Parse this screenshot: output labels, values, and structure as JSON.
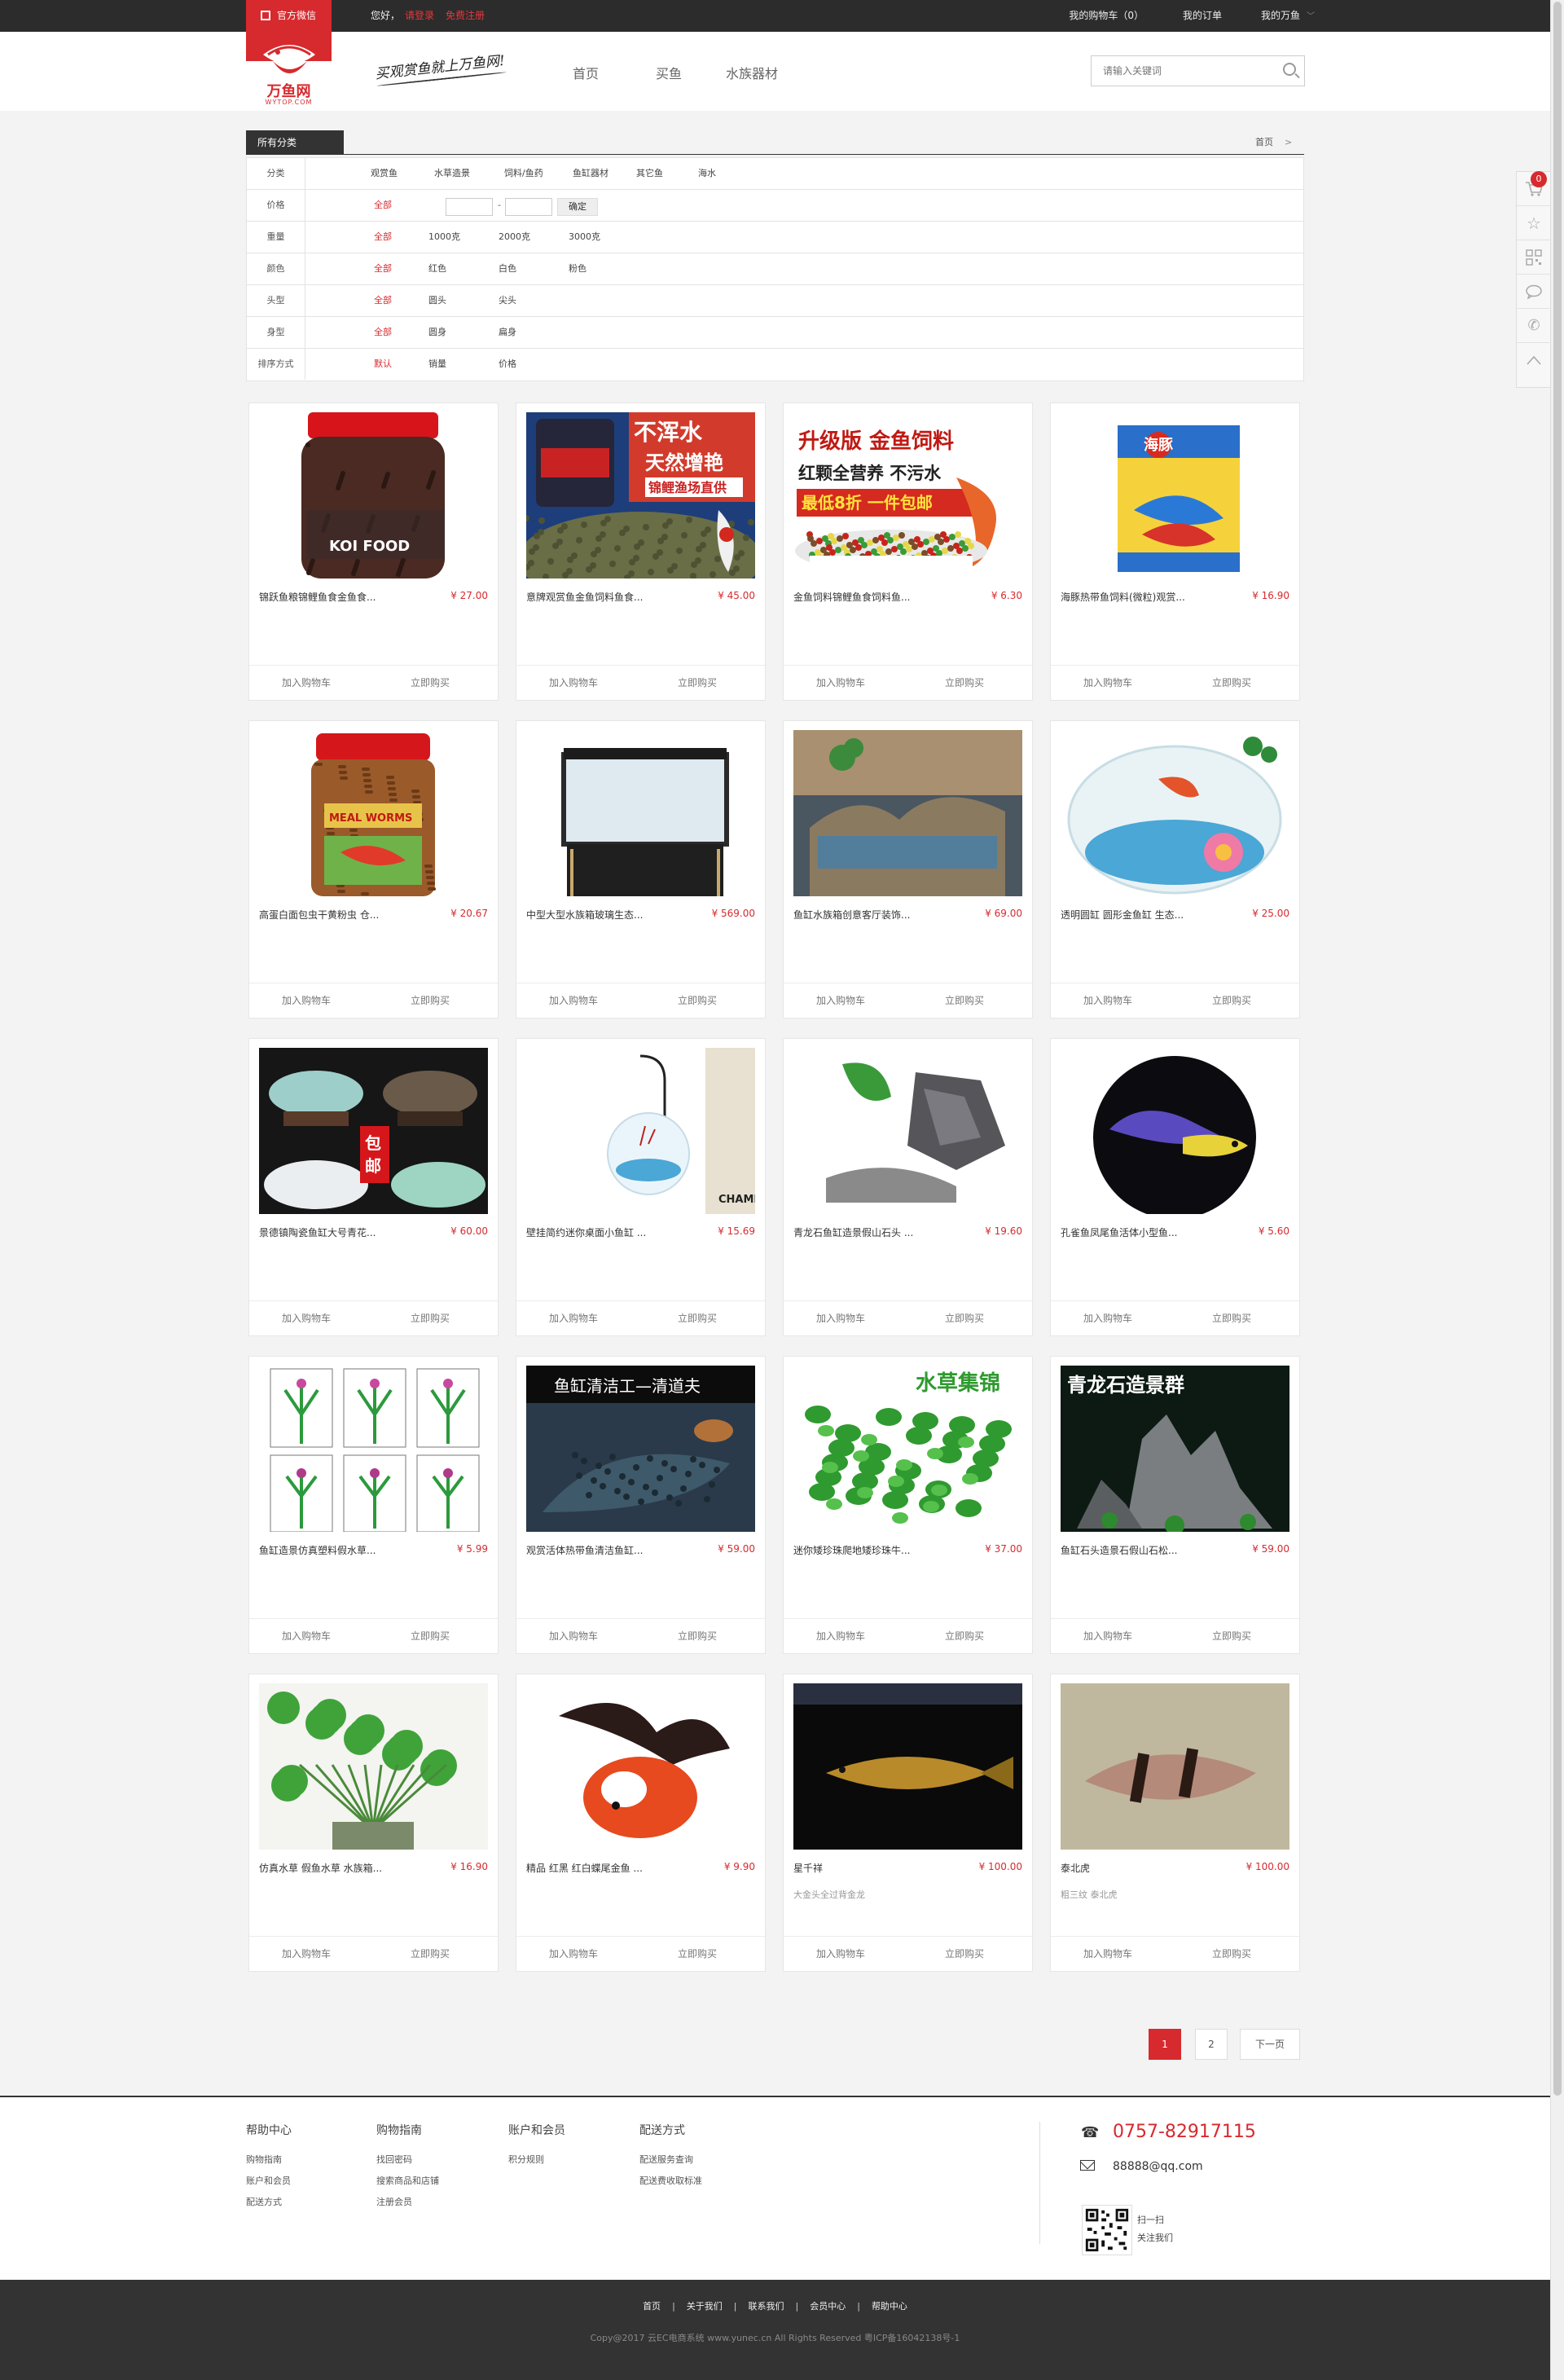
{
  "topbar": {
    "official_label": "官方微信",
    "greeting": "您好，",
    "login": "请登录",
    "register": "免费注册",
    "cart": "我的购物车（0）",
    "orders": "我的订单",
    "account": "我的万鱼"
  },
  "header": {
    "logo_text": "万鱼网",
    "logo_sub": "WYTOP.COM",
    "slogan": "买观赏鱼就上万鱼网!",
    "nav": [
      "首页",
      "买鱼",
      "水族器材"
    ],
    "search_placeholder": "请输入关键词"
  },
  "breadcrumb": {
    "all_categories": "所有分类",
    "home": "首页",
    "arrow": ">"
  },
  "filters": [
    {
      "label": "分类",
      "options": [
        "观赏鱼",
        "水草造景",
        "饲料/鱼药",
        "鱼缸器材",
        "其它鱼",
        "海水"
      ],
      "active": -1
    },
    {
      "label": "价格",
      "options": [
        "全部"
      ],
      "active": 0,
      "price": true,
      "dash": "-",
      "confirm": "确定"
    },
    {
      "label": "重量",
      "options": [
        "全部",
        "1000克",
        "2000克",
        "3000克"
      ],
      "active": 0
    },
    {
      "label": "颜色",
      "options": [
        "全部",
        "红色",
        "白色",
        "粉色"
      ],
      "active": 0
    },
    {
      "label": "头型",
      "options": [
        "全部",
        "圆头",
        "尖头"
      ],
      "active": 0
    },
    {
      "label": "身型",
      "options": [
        "全部",
        "圆身",
        "扁身"
      ],
      "active": 0
    },
    {
      "label": "排序方式",
      "options": [
        "默认",
        "销量",
        "价格"
      ],
      "active": 0
    }
  ],
  "product_actions": {
    "add_cart": "加入购物车",
    "buy_now": "立即购买"
  },
  "products": [
    {
      "name": "锦跃鱼粮锦鲤鱼食金鱼食...",
      "price": "¥ 27.00",
      "img": "koi-food-jar"
    },
    {
      "name": "意牌观赏鱼金鱼饲料鱼食...",
      "price": "¥ 45.00",
      "img": "fish-food-pellets"
    },
    {
      "name": "金鱼饲料锦鲤鱼食饲料鱼...",
      "price": "¥ 6.30",
      "img": "goldfish-feed-bowl"
    },
    {
      "name": "海豚热带鱼饲料(微粒)观赏...",
      "price": "¥ 16.90",
      "img": "tropical-fish-food-box"
    },
    {
      "name": "高蛋白面包虫干黄粉虫 仓...",
      "price": "¥ 20.67",
      "img": "mealworm-jar"
    },
    {
      "name": "中型大型水族箱玻璃生态...",
      "price": "¥ 569.00",
      "img": "glass-aquarium"
    },
    {
      "name": "鱼缸水族箱创意客厅装饰...",
      "price": "¥ 69.00",
      "img": "decor-aquarium"
    },
    {
      "name": "透明圆缸 圆形金鱼缸 生态...",
      "price": "¥ 25.00",
      "img": "round-fishbowl"
    },
    {
      "name": "景德镇陶瓷鱼缸大号青花...",
      "price": "¥ 60.00",
      "img": "ceramic-bowls"
    },
    {
      "name": "壁挂简约迷你桌面小鱼缸 ...",
      "price": "¥ 15.69",
      "img": "hanging-fishbowl"
    },
    {
      "name": "青龙石鱼缸造景假山石头 ...",
      "price": "¥ 19.60",
      "img": "dragon-stone"
    },
    {
      "name": "孔雀鱼凤尾鱼活体小型鱼...",
      "price": "¥ 5.60",
      "img": "guppy"
    },
    {
      "name": "鱼缸造景仿真塑料假水草...",
      "price": "¥ 5.99",
      "img": "plastic-plants"
    },
    {
      "name": "观赏活体热带鱼清洁鱼缸...",
      "price": "¥ 59.00",
      "img": "pleco-fish"
    },
    {
      "name": "迷你矮珍珠爬地矮珍珠牛...",
      "price": "¥ 37.00",
      "img": "water-plants"
    },
    {
      "name": "鱼缸石头造景石假山石松...",
      "price": "¥ 59.00",
      "img": "rock-scape"
    },
    {
      "name": "仿真水草 假鱼水草 水族箱...",
      "price": "¥ 16.90",
      "img": "pennywort"
    },
    {
      "name": "精品 红黑 红白蝶尾金鱼 ...",
      "price": "¥ 9.90",
      "img": "butterfly-goldfish"
    },
    {
      "name": "星千祥",
      "price": "¥ 100.00",
      "sub": "大金头全过背金龙",
      "img": "arowana"
    },
    {
      "name": "泰北虎",
      "price": "¥ 100.00",
      "sub": "粗三纹 泰北虎",
      "img": "tiger-fish"
    }
  ],
  "category_labels": {
    "p1": "KOI FOOD",
    "p2_title": "不浑水",
    "p2_line2": "天然增艳",
    "p2_line3": "锦鲤渔场直供",
    "p3_l1": "升级版 金鱼饲料",
    "p3_l2": "红颗全营养 不污水",
    "p3_l3": "最低8折 一件包邮",
    "p4": "海豚",
    "p5": "MEAL WORMS",
    "p9": "包邮",
    "p10": "CHAMPION",
    "p14": "鱼缸清洁工—清道夫",
    "p15": "水草集锦",
    "p16": "青龙石造景群"
  },
  "pagination": {
    "pages": [
      "1",
      "2"
    ],
    "next": "下一页",
    "current": 0
  },
  "sidebar": {
    "cart_count": "0"
  },
  "footer": {
    "cols": [
      {
        "title": "帮助中心",
        "links": [
          "购物指南",
          "账户和会员",
          "配送方式"
        ]
      },
      {
        "title": "购物指南",
        "links": [
          "找回密码",
          "搜索商品和店铺",
          "注册会员"
        ]
      },
      {
        "title": "账户和会员",
        "links": [
          "积分规则"
        ]
      },
      {
        "title": "配送方式",
        "links": [
          "配送服务查询",
          "配送费收取标准"
        ]
      }
    ],
    "phone": "0757-82917115",
    "email": "88888@qq.com",
    "qr_line1": "扫一扫",
    "qr_line2": "关注我们",
    "bottom_links": [
      "首页",
      "关于我们",
      "联系我们",
      "会员中心",
      "帮助中心"
    ],
    "copyright": "Copy@2017 云EC电商系统 www.yunec.cn All Rights Reserved 粤ICP备16042138号-1"
  },
  "colors": {
    "accent": "#d72a2e",
    "dark": "#2c2c2c"
  }
}
